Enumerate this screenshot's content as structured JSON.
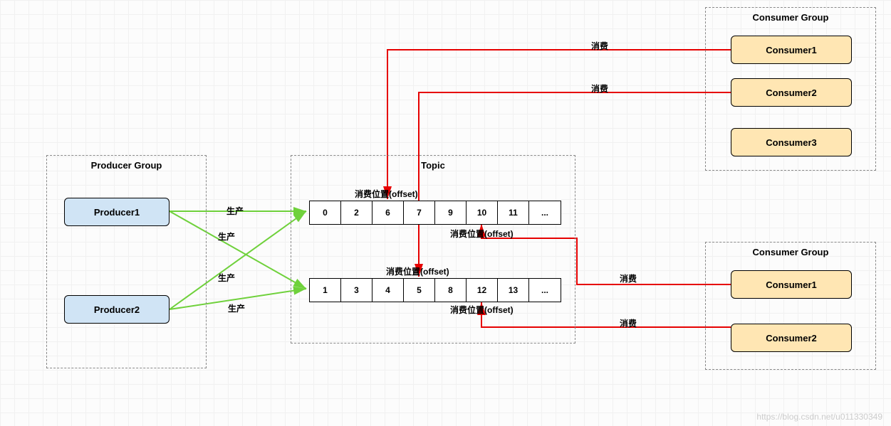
{
  "producer_group": {
    "title": "Producer Group",
    "producers": [
      "Producer1",
      "Producer2"
    ]
  },
  "topic": {
    "title": "Topic",
    "queues": [
      {
        "cells": [
          "0",
          "2",
          "6",
          "7",
          "9",
          "10",
          "11",
          "..."
        ]
      },
      {
        "cells": [
          "1",
          "3",
          "4",
          "5",
          "8",
          "12",
          "13",
          "..."
        ]
      }
    ],
    "offset_label": "消费位置(offset)"
  },
  "consumer_group_top": {
    "title": "Consumer Group",
    "consumers": [
      "Consumer1",
      "Consumer2",
      "Consumer3"
    ]
  },
  "consumer_group_bottom": {
    "title": "Consumer Group",
    "consumers": [
      "Consumer1",
      "Consumer2"
    ]
  },
  "labels": {
    "produce": "生产",
    "consume": "消费"
  },
  "watermark": "https://blog.csdn.net/u011330349"
}
